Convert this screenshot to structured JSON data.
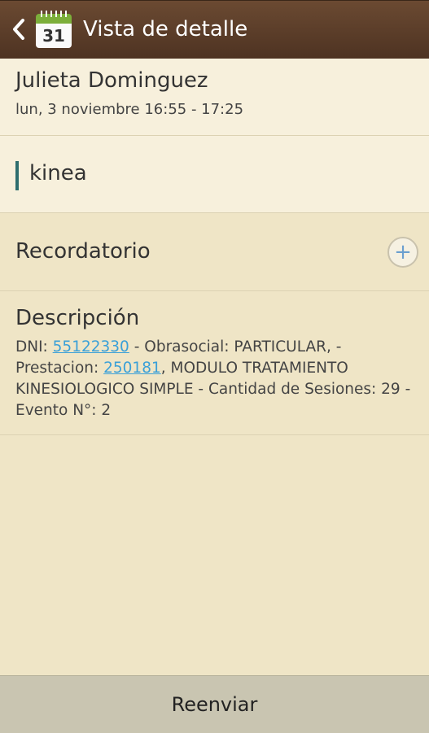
{
  "actionbar": {
    "calendar_day": "31",
    "title": "Vista de detalle"
  },
  "event": {
    "name": "Julieta Dominguez",
    "datetime": "lun, 3 noviembre 16:55 - 17:25",
    "calendar": "kinea"
  },
  "reminder": {
    "label": "Recordatorio"
  },
  "description": {
    "label": "Descripción",
    "dni_prefix": "DNI: ",
    "dni": "55122330",
    "mid1": " - Obrasocial: PARTICULAR,  - Prestacion: ",
    "prestacion": "250181",
    "rest": ", MODULO TRATAMIENTO KINESIOLOGICO SIMPLE - Cantidad de Sesiones: 29 - Evento N°: 2"
  },
  "footer": {
    "resend_label": "Reenviar"
  },
  "colors": {
    "actionbar": "#5c3d28",
    "background": "#efe5c6",
    "link": "#3aa0d8",
    "calendar_accent": "#2e6e6e"
  }
}
